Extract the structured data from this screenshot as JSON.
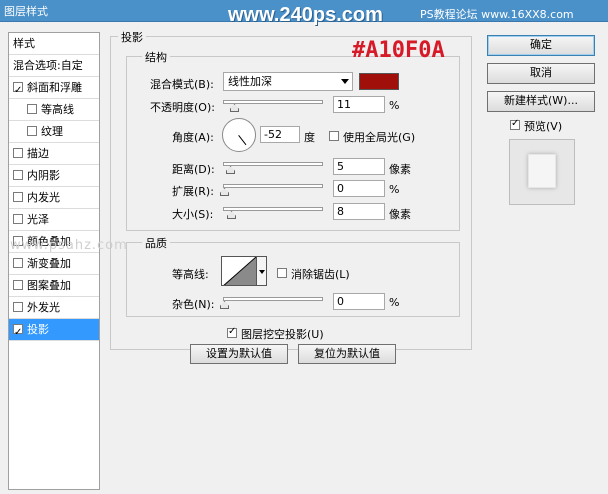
{
  "window": {
    "title": "图层样式"
  },
  "watermarks": {
    "site": "www.240ps.com",
    "site2": "PS教程论坛 www.16XX8.com",
    "mid": "www.psahz.com"
  },
  "annotation": {
    "color_code": "#A10F0A"
  },
  "left_panel": {
    "items": [
      {
        "label": "样式",
        "checkbox": false,
        "indent": false,
        "selected": false
      },
      {
        "label": "混合选项:自定",
        "checkbox": false,
        "indent": false,
        "selected": false
      },
      {
        "label": "斜面和浮雕",
        "checkbox": true,
        "checked": true,
        "indent": false,
        "selected": false
      },
      {
        "label": "等高线",
        "checkbox": true,
        "checked": false,
        "indent": true,
        "selected": false
      },
      {
        "label": "纹理",
        "checkbox": true,
        "checked": false,
        "indent": true,
        "selected": false
      },
      {
        "label": "描边",
        "checkbox": true,
        "checked": false,
        "indent": false,
        "selected": false
      },
      {
        "label": "内阴影",
        "checkbox": true,
        "checked": false,
        "indent": false,
        "selected": false
      },
      {
        "label": "内发光",
        "checkbox": true,
        "checked": false,
        "indent": false,
        "selected": false
      },
      {
        "label": "光泽",
        "checkbox": true,
        "checked": false,
        "indent": false,
        "selected": false
      },
      {
        "label": "颜色叠加",
        "checkbox": true,
        "checked": false,
        "indent": false,
        "selected": false
      },
      {
        "label": "渐变叠加",
        "checkbox": true,
        "checked": false,
        "indent": false,
        "selected": false
      },
      {
        "label": "图案叠加",
        "checkbox": true,
        "checked": false,
        "indent": false,
        "selected": false
      },
      {
        "label": "外发光",
        "checkbox": true,
        "checked": false,
        "indent": false,
        "selected": false
      },
      {
        "label": "投影",
        "checkbox": true,
        "checked": true,
        "indent": false,
        "selected": true
      }
    ]
  },
  "drop_shadow": {
    "section_title": "投影",
    "structure": {
      "title": "结构",
      "blend_mode_label": "混合模式(B):",
      "blend_mode_value": "线性加深",
      "shadow_color": "#a10f0a",
      "opacity_label": "不透明度(O):",
      "opacity_value": "11",
      "opacity_unit": "%",
      "angle_label": "角度(A):",
      "angle_value": "-52",
      "angle_unit": "度",
      "global_light_label": "使用全局光(G)",
      "distance_label": "距离(D):",
      "distance_value": "5",
      "distance_unit": "像素",
      "spread_label": "扩展(R):",
      "spread_value": "0",
      "spread_unit": "%",
      "size_label": "大小(S):",
      "size_value": "8",
      "size_unit": "像素"
    },
    "quality": {
      "title": "品质",
      "contour_label": "等高线:",
      "antialias_label": "消除锯齿(L)",
      "noise_label": "杂色(N):",
      "noise_value": "0",
      "noise_unit": "%"
    },
    "knockout_label": "图层挖空投影(U)",
    "make_default_label": "设置为默认值",
    "reset_default_label": "复位为默认值"
  },
  "right_panel": {
    "ok_label": "确定",
    "cancel_label": "取消",
    "new_style_label": "新建样式(W)...",
    "preview_label": "预览(V)"
  }
}
